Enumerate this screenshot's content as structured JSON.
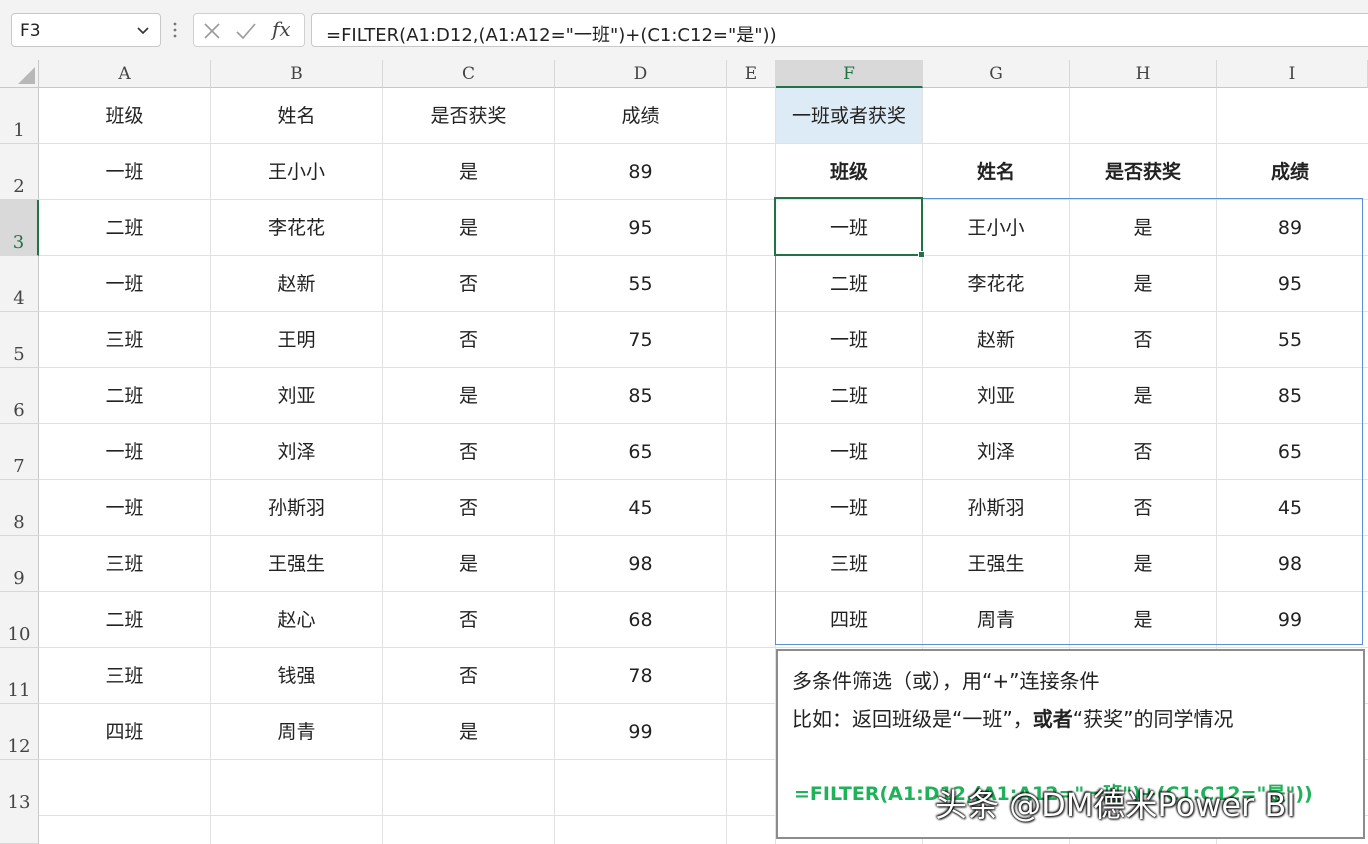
{
  "formula_bar": {
    "name_box": "F3",
    "fx_label": "fx",
    "formula": "=FILTER(A1:D12,(A1:A12=\"一班\")+(C1:C12=\"是\"))"
  },
  "columns": [
    "A",
    "B",
    "C",
    "D",
    "E",
    "F",
    "G",
    "H",
    "I"
  ],
  "rows": [
    "1",
    "2",
    "3",
    "4",
    "5",
    "6",
    "7",
    "8",
    "9",
    "10",
    "11",
    "12",
    "13"
  ],
  "source_table": {
    "headers": [
      "班级",
      "姓名",
      "是否获奖",
      "成绩"
    ],
    "rows": [
      [
        "一班",
        "王小小",
        "是",
        "89"
      ],
      [
        "二班",
        "李花花",
        "是",
        "95"
      ],
      [
        "一班",
        "赵新",
        "否",
        "55"
      ],
      [
        "三班",
        "王明",
        "否",
        "75"
      ],
      [
        "二班",
        "刘亚",
        "是",
        "85"
      ],
      [
        "一班",
        "刘泽",
        "否",
        "65"
      ],
      [
        "一班",
        "孙斯羽",
        "否",
        "45"
      ],
      [
        "三班",
        "王强生",
        "是",
        "98"
      ],
      [
        "二班",
        "赵心",
        "否",
        "68"
      ],
      [
        "三班",
        "钱强",
        "否",
        "78"
      ],
      [
        "四班",
        "周青",
        "是",
        "99"
      ]
    ]
  },
  "result_table": {
    "title": "一班或者获奖",
    "headers": [
      "班级",
      "姓名",
      "是否获奖",
      "成绩"
    ],
    "rows": [
      [
        "一班",
        "王小小",
        "是",
        "89"
      ],
      [
        "二班",
        "李花花",
        "是",
        "95"
      ],
      [
        "一班",
        "赵新",
        "否",
        "55"
      ],
      [
        "二班",
        "刘亚",
        "是",
        "85"
      ],
      [
        "一班",
        "刘泽",
        "否",
        "65"
      ],
      [
        "一班",
        "孙斯羽",
        "否",
        "45"
      ],
      [
        "三班",
        "王强生",
        "是",
        "98"
      ],
      [
        "四班",
        "周青",
        "是",
        "99"
      ]
    ]
  },
  "note": {
    "line1": "多条件筛选（或），用“+”连接条件",
    "line2_prefix": "比如：返回班级是“一班”，",
    "line2_bold": "或者",
    "line2_suffix": "“获奖”的同学情况",
    "formula": "=FILTER(A1:D12,(A1:A12=\"一班\")+(C1:C12=\"是\"))"
  },
  "watermark": "头条 @DM德米Power BI",
  "colors": {
    "accent_green": "#217346",
    "formula_green": "#1fb25a",
    "spill_blue": "#5b8fd6",
    "highlight": "#ddebf7"
  },
  "icons": [
    "chevron-down-icon",
    "cancel-icon",
    "confirm-icon",
    "fx-icon",
    "select-all-icon"
  ]
}
